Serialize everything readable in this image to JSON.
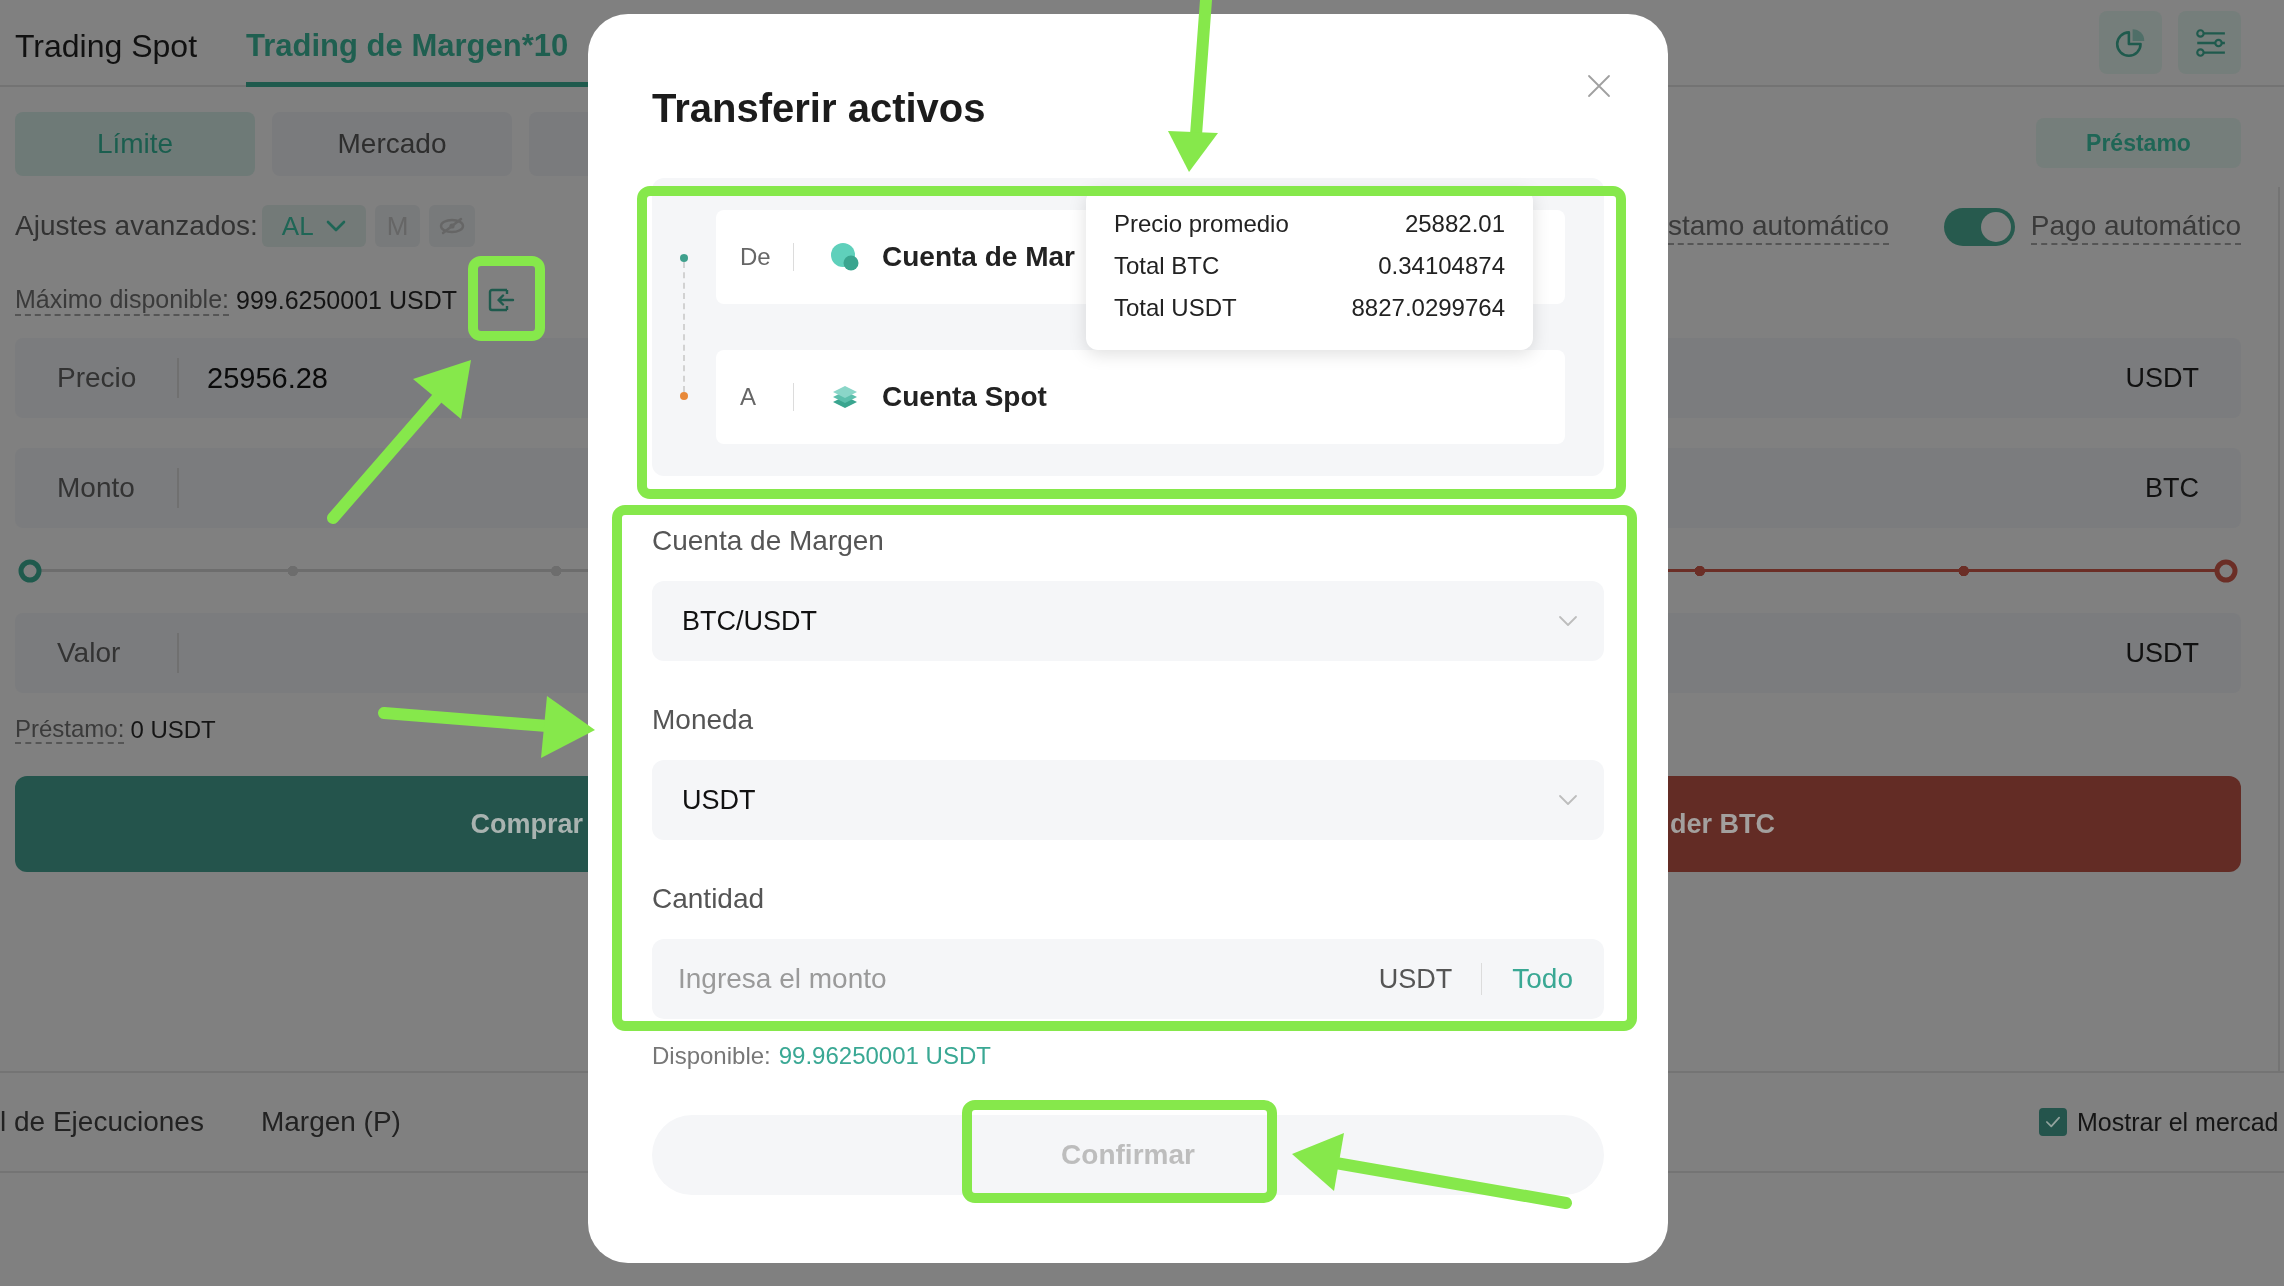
{
  "header": {
    "tabs": [
      {
        "label": "Trading Spot",
        "selected": false
      },
      {
        "label": "Trading de Margen*10",
        "selected": true
      }
    ]
  },
  "order_types": [
    {
      "label": "Límite",
      "selected": true
    },
    {
      "label": "Mercado",
      "selected": false
    },
    {
      "selected": false
    }
  ],
  "loan_button": "Préstamo",
  "advanced_settings": {
    "label": "Ajustes avanzados:",
    "options": [
      {
        "kind": "dropdown",
        "label": "AL",
        "selected": true
      },
      {
        "kind": "text",
        "label": "M",
        "selected": false
      },
      {
        "kind": "icon",
        "selected": false
      }
    ]
  },
  "auto_loan": {
    "label": "stamo automático"
  },
  "auto_repay": {
    "label": "Pago automático",
    "on": true
  },
  "max_available": {
    "label": "Máximo disponible:",
    "value": "999.6250001 USDT"
  },
  "buy_panel": {
    "rows": [
      {
        "kind": "field",
        "label": "Precio",
        "value": "25956.28"
      },
      {
        "kind": "field",
        "label": "Monto"
      },
      {
        "kind": "slider",
        "level": 0
      },
      {
        "kind": "field",
        "label": "Valor"
      }
    ],
    "loan": {
      "label": "Préstamo:",
      "value": "0 USDT"
    },
    "button": "Comprar"
  },
  "sell_panel": {
    "rows": [
      {
        "kind": "field",
        "unit": "USDT"
      },
      {
        "kind": "field",
        "unit": "BTC"
      },
      {
        "kind": "slider",
        "level": 1
      },
      {
        "kind": "field",
        "unit": "USDT"
      }
    ],
    "button": "der BTC"
  },
  "bottom_tabs": [
    {
      "label": "l de Ejecuciones"
    },
    {
      "label": "Margen (P)"
    }
  ],
  "show_market": {
    "label": "Mostrar el mercad",
    "checked": true
  },
  "dialog": {
    "title": "Transferir activos",
    "accounts": [
      {
        "role": "De",
        "name": "Cuenta de Mar",
        "kind": "margin",
        "color": "#3fa08d"
      },
      {
        "role": "A",
        "name": "Cuenta Spot",
        "kind": "spot",
        "color": "#e8893a"
      }
    ],
    "tooltip": [
      {
        "label": "Precio promedio",
        "value": "25882.01"
      },
      {
        "label": "Total BTC",
        "value": "0.34104874"
      },
      {
        "label": "Total USDT",
        "value": "8827.0299764"
      }
    ],
    "fields": [
      {
        "kind": "select",
        "label": "Cuenta de Margen",
        "value": "BTC/USDT"
      },
      {
        "kind": "select",
        "label": "Moneda",
        "value": "USDT"
      },
      {
        "kind": "amount",
        "label": "Cantidad",
        "placeholder": "Ingresa el monto",
        "unit": "USDT",
        "action": "Todo"
      }
    ],
    "available": {
      "label": "Disponible:",
      "value": "99.96250001 USDT"
    },
    "confirm": {
      "label": "Confirmar",
      "disabled": true
    }
  }
}
